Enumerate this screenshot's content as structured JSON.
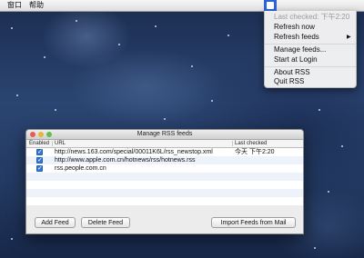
{
  "menubar": {
    "items": [
      "窗口",
      "帮助"
    ]
  },
  "status_menu": {
    "icon": "rss-icon",
    "accent_color": "#2d63d7",
    "items": [
      {
        "label": "Last checked: 下午2:20",
        "disabled": true
      },
      {
        "label": "Refresh now"
      },
      {
        "label": "Refresh feeds",
        "submenu": true
      },
      {
        "label": "Manage feeds..."
      },
      {
        "label": "Start at Login"
      },
      {
        "label": "About RSS"
      },
      {
        "label": "Quit RSS"
      }
    ]
  },
  "window": {
    "title": "Manage RSS feeds",
    "traffic_lights": [
      "#ec5a52",
      "#e5b63b",
      "#60c04a"
    ],
    "columns": {
      "enabled": "Enabled",
      "url": "URL",
      "last_checked": "Last checked"
    },
    "rows": [
      {
        "enabled": true,
        "url": "http://news.163.com/special/00011K6L/rss_newstop.xml",
        "last_checked": "今天 下午2:20"
      },
      {
        "enabled": true,
        "url": "http://www.apple.com.cn/hotnews/rss/hotnews.rss",
        "last_checked": ""
      },
      {
        "enabled": true,
        "url": "rss.people.com.cn",
        "last_checked": ""
      }
    ],
    "buttons": {
      "add": "Add Feed",
      "delete": "Delete Feed",
      "import": "Import Feeds from Mail"
    }
  }
}
